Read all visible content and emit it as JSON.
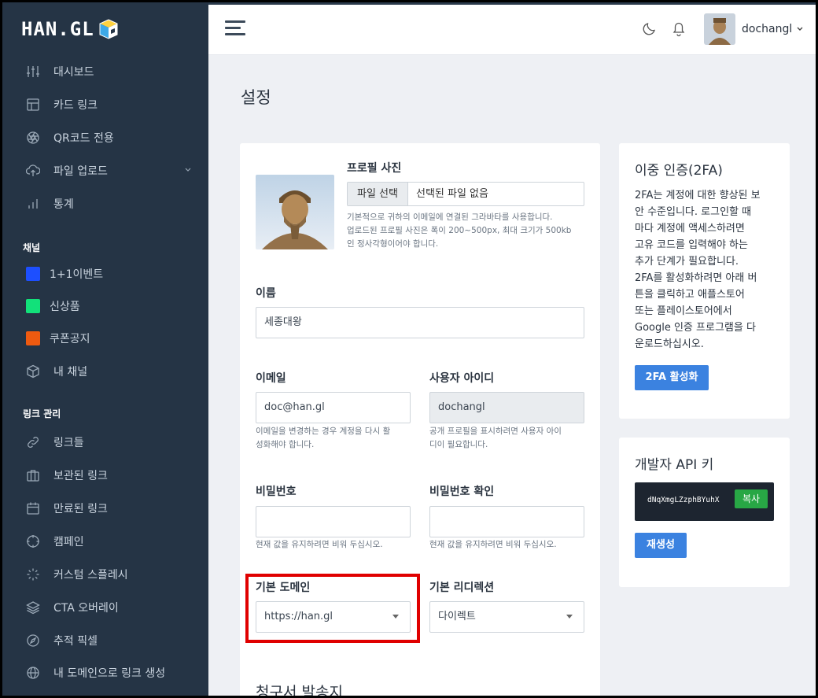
{
  "brand": {
    "logo_text": "HAN.GL"
  },
  "sidebar": {
    "items": [
      {
        "label": "대시보드",
        "icon": "sliders-icon"
      },
      {
        "label": "카드 링크",
        "icon": "layout-icon"
      },
      {
        "label": "QR코드 전용",
        "icon": "aperture-icon"
      },
      {
        "label": "파일 업로드",
        "icon": "upload-cloud-icon"
      },
      {
        "label": "통계",
        "icon": "bar-chart-icon"
      }
    ],
    "channels_label": "채널",
    "channels": [
      {
        "label": "1+1이벤트",
        "color": "#1d4fff"
      },
      {
        "label": "신상품",
        "color": "#12e17a"
      },
      {
        "label": "쿠폰공지",
        "color": "#ee5a10"
      },
      {
        "label": "내 채널",
        "icon": "box-icon"
      }
    ],
    "links_label": "링크 관리",
    "links": [
      {
        "label": "링크들",
        "icon": "link-icon"
      },
      {
        "label": "보관된 링크",
        "icon": "briefcase-icon"
      },
      {
        "label": "만료된 링크",
        "icon": "calendar-icon"
      },
      {
        "label": "캠페인",
        "icon": "crosshair-icon"
      },
      {
        "label": "커스텀 스플레시",
        "icon": "loader-icon"
      },
      {
        "label": "CTA 오버레이",
        "icon": "layers-icon"
      },
      {
        "label": "추적 픽셀",
        "icon": "compass-icon"
      },
      {
        "label": "내 도메인으로 링크 생성",
        "icon": "globe-icon"
      }
    ]
  },
  "topbar": {
    "username": "dochangl"
  },
  "page": {
    "title": "설정"
  },
  "profile": {
    "photo_label": "프로필 사진",
    "file_button": "파일 선택",
    "file_status": "선택된 파일 없음",
    "photo_help": [
      "기본적으로 귀하의 이메일에 연결된 그라바타를 사용합니다.",
      "업로드된 프로필 사진은 폭이 200~500px, 최대 크기가 500kb",
      "인 정사각형이어야 합니다."
    ],
    "name_label": "이름",
    "name_value": "세종대왕",
    "email_label": "이메일",
    "email_value": "doc@han.gl",
    "email_help": [
      "이메일을 변경하는 경우 계정을 다시 활",
      "성화해야 합니다."
    ],
    "userid_label": "사용자 아이디",
    "userid_value": "dochangl",
    "userid_help": [
      "공개 프로필을 표시하려면 사용자 아이",
      "디이 필요합니다."
    ],
    "password_label": "비밀번호",
    "password_help": "현재 값을 유지하려면 비워 두십시오.",
    "password_confirm_label": "비밀번호 확인",
    "password_confirm_help": "현재 값을 유지하려면 비워 두십시오.",
    "domain_label": "기본 도메인",
    "domain_value": "https://han.gl",
    "redirect_label": "기본 리디렉션",
    "redirect_value": "다이렉트",
    "billing_title": "청구서 발송지"
  },
  "twofa": {
    "title": "이중 인증(2FA)",
    "body_lines": [
      "2FA는 계정에 대한 향상된 보",
      "안 수준입니다. 로그인할 때",
      "마다 계정에 액세스하려면",
      "고유 코드를 입력해야 하는",
      "추가 단계가 필요합니다.",
      "2FA를 활성화하려면 아래 버",
      "튼을 클릭하고 애플스토어",
      "또는 플레이스토어에서",
      "Google 인증 프로그램을 다",
      "운로드하십시오."
    ],
    "button": "2FA 활성화"
  },
  "api": {
    "title": "개발자 API 키",
    "key": "dNqXmgLZzphBYuhX",
    "copy_button": "복사",
    "regen_button": "재생성"
  }
}
